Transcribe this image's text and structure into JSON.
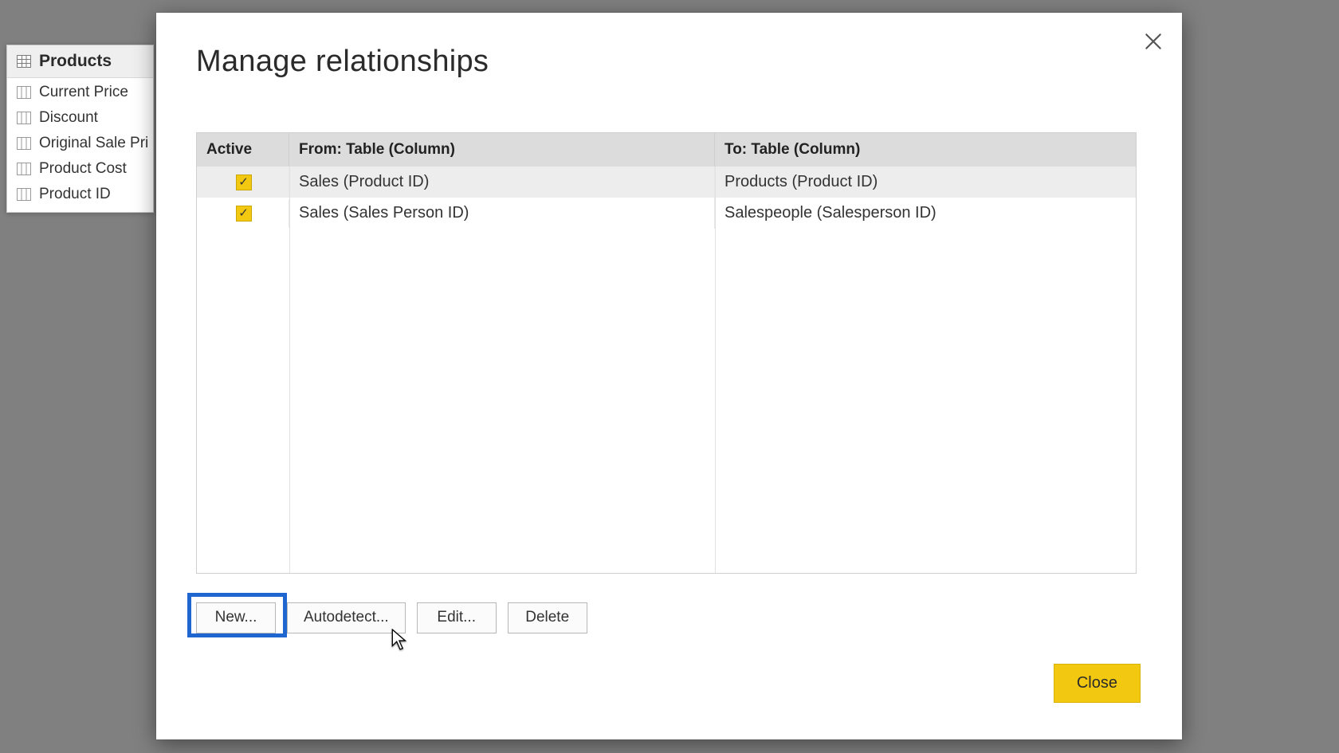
{
  "sidebar": {
    "table_name": "Products",
    "columns": [
      "Current Price",
      "Discount",
      "Original Sale Pri",
      "Product Cost",
      "Product ID"
    ]
  },
  "dialog": {
    "title": "Manage relationships",
    "headers": {
      "active": "Active",
      "from": "From: Table (Column)",
      "to": "To: Table (Column)"
    },
    "rows": [
      {
        "active": true,
        "from": "Sales (Product ID)",
        "to": "Products (Product ID)",
        "selected": true
      },
      {
        "active": true,
        "from": "Sales (Sales Person ID)",
        "to": "Salespeople (Salesperson ID)",
        "selected": false
      }
    ],
    "buttons": {
      "new": "New...",
      "autodetect": "Autodetect...",
      "edit": "Edit...",
      "delete": "Delete",
      "close": "Close"
    }
  },
  "colors": {
    "accent": "#f2c811",
    "highlight": "#1f66d0"
  }
}
